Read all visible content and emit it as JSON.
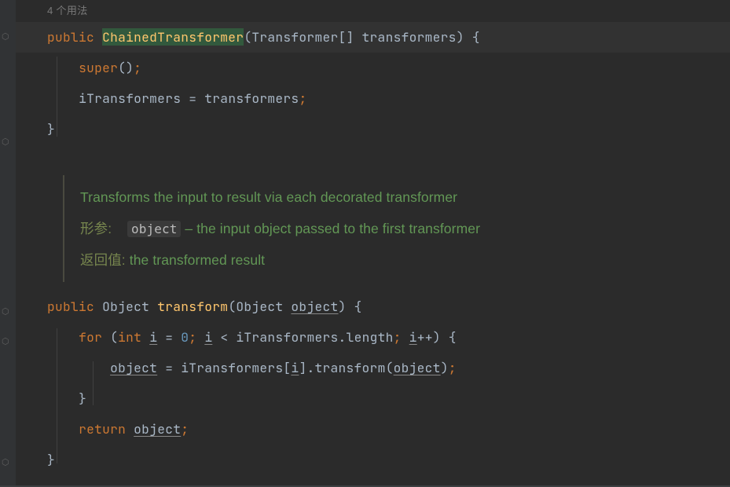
{
  "hint": {
    "usages": "4 个用法"
  },
  "constr": {
    "kw_public": "public",
    "name": "ChainedTransformer",
    "param_type": "Transformer[]",
    "param_name": "transformers",
    "body": {
      "super_kw": "super",
      "lhs": "iTransformers",
      "rhs": "transformers"
    }
  },
  "doc": {
    "summary": "Transforms the input to result via each decorated transformer",
    "param_label": "形参:",
    "param_name": "object",
    "param_desc": " – the input object passed to the first transformer",
    "return_label": "返回值:",
    "return_desc": " the transformed result"
  },
  "method": {
    "kw_public": "public",
    "ret_type": "Object",
    "name": "transform",
    "param_type": "Object",
    "param_name": "object",
    "for_kw": "for",
    "int_kw": "int",
    "i": "i",
    "zero": "0",
    "arr": "iTransformers",
    "length": "length",
    "call": "transform",
    "return_kw": "return"
  }
}
